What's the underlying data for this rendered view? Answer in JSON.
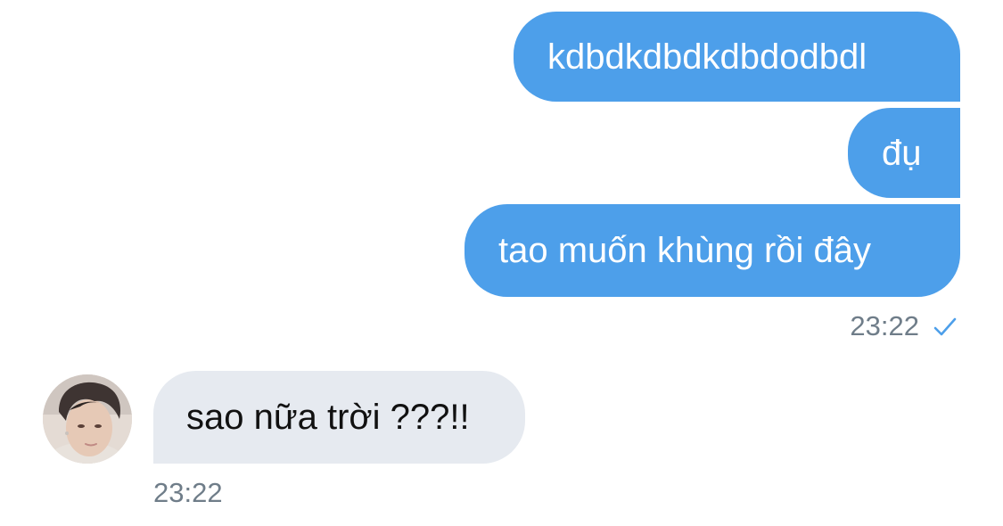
{
  "messages": {
    "outgoing": [
      {
        "text": "kdbdkdbdkdbdodbdl"
      },
      {
        "text": "đụ"
      },
      {
        "text": "tao muốn khùng rồi đây"
      }
    ],
    "outgoing_time": "23:22",
    "outgoing_status_icon": "single-check-icon",
    "incoming": [
      {
        "text": "sao nữa trời ???!!"
      }
    ],
    "incoming_time": "23:22"
  },
  "colors": {
    "outgoing_bubble": "#4d9fea",
    "incoming_bubble": "#e6eaf0",
    "timestamp": "#6f7d89",
    "check": "#4d9fea"
  }
}
